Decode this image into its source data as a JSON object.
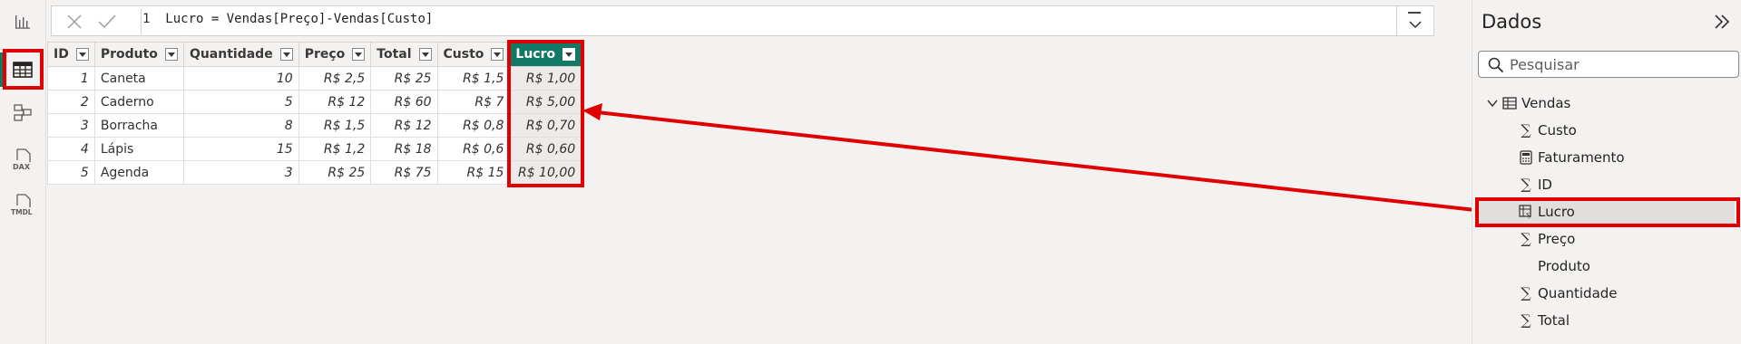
{
  "left_rail": {
    "items": [
      {
        "name": "report-view",
        "icon": "bar-chart-icon"
      },
      {
        "name": "table-view",
        "icon": "table-grid-icon",
        "active": true
      },
      {
        "name": "model-view",
        "icon": "model-diagram-icon"
      },
      {
        "name": "dax-query-view",
        "icon": "dax-icon",
        "caption": "DAX"
      },
      {
        "name": "tmdl-view",
        "icon": "tmdl-icon",
        "caption": "TMDL"
      }
    ]
  },
  "formula_bar": {
    "line_number": "1",
    "formula": "Lucro = Vendas[Preço]-Vendas[Custo]"
  },
  "table": {
    "columns": [
      "ID",
      "Produto",
      "Quantidade",
      "Preço",
      "Total",
      "Custo",
      "Lucro"
    ],
    "selected_column": "Lucro",
    "rows": [
      [
        "1",
        "Caneta",
        "10",
        "R$ 2,5",
        "R$ 25",
        "R$ 1,5",
        "R$ 1,00"
      ],
      [
        "2",
        "Caderno",
        "5",
        "R$ 12",
        "R$ 60",
        "R$ 7",
        "R$ 5,00"
      ],
      [
        "3",
        "Borracha",
        "8",
        "R$ 1,5",
        "R$ 12",
        "R$ 0,8",
        "R$ 0,70"
      ],
      [
        "4",
        "Lápis",
        "15",
        "R$ 1,2",
        "R$ 18",
        "R$ 0,6",
        "R$ 0,60"
      ],
      [
        "5",
        "Agenda",
        "3",
        "R$ 25",
        "R$ 75",
        "R$ 15",
        "R$ 10,00"
      ]
    ]
  },
  "data_pane": {
    "title": "Dados",
    "search_placeholder": "Pesquisar",
    "table_name": "Vendas",
    "fields": [
      {
        "label": "Custo",
        "icon": "sigma-icon"
      },
      {
        "label": "Faturamento",
        "icon": "calculator-icon"
      },
      {
        "label": "ID",
        "icon": "sigma-icon"
      },
      {
        "label": "Lucro",
        "icon": "calculated-column-icon",
        "selected": true
      },
      {
        "label": "Preço",
        "icon": "sigma-icon"
      },
      {
        "label": "Produto",
        "icon": ""
      },
      {
        "label": "Quantidade",
        "icon": "sigma-icon"
      },
      {
        "label": "Total",
        "icon": "sigma-icon"
      }
    ]
  },
  "colors": {
    "accent": "#117865",
    "highlight_red": "#e00000",
    "background": "#f3f2f1"
  }
}
